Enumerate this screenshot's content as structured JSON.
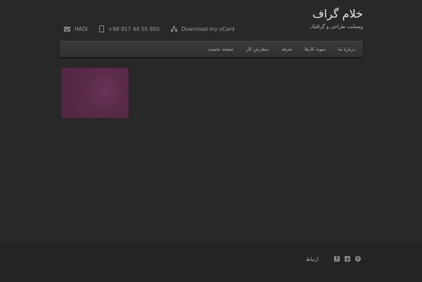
{
  "header": {
    "site_title": "خلام گراف",
    "tagline": "وبسایت طراحی و گرافیک"
  },
  "contact": {
    "name": "HADI",
    "phone": "+98 917 44 55 900",
    "vcard_label": "Download my vCard"
  },
  "nav": {
    "items": [
      {
        "label": "صفحه نخست"
      },
      {
        "label": "سفارش کار"
      },
      {
        "label": "تعرفه"
      },
      {
        "label": "نمونه کارها"
      },
      {
        "label": "درباره ما"
      }
    ]
  },
  "footer": {
    "contact_label": "ارتباط"
  },
  "icons": {
    "contact": [
      "mail-icon",
      "phone-icon",
      "sitemap-icon"
    ],
    "social": [
      "facebook-icon",
      "grid-icon",
      "skype-icon"
    ]
  },
  "colors": {
    "background": "#282828",
    "nav_background": "#353535",
    "thumbnail": "#5a2b49"
  }
}
